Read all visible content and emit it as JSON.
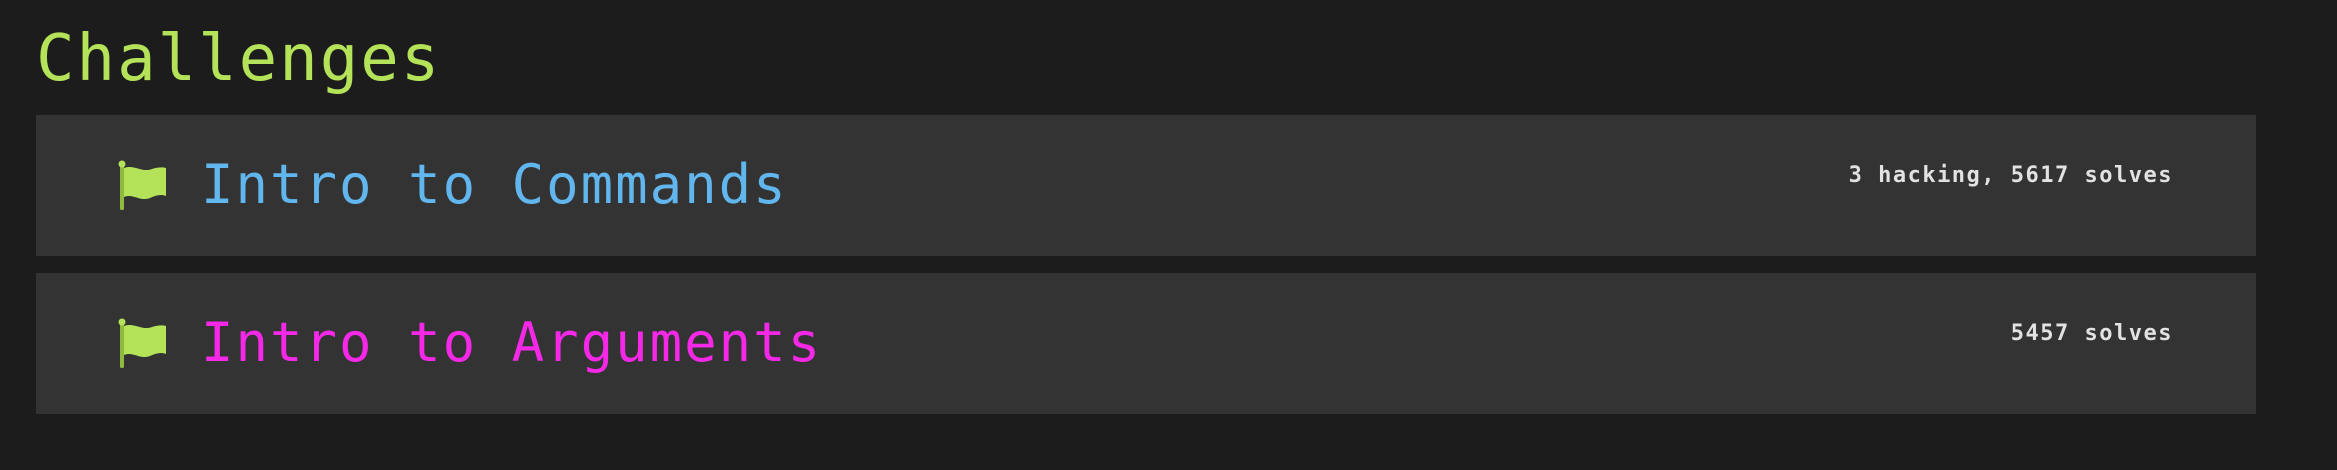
{
  "page": {
    "title": "Challenges"
  },
  "challenges": [
    {
      "name": "Intro to Commands",
      "stats": "3 hacking, 5617 solves",
      "name_color": "#62b6ee",
      "flag_icon": "flag-icon",
      "flag_color": "#b4e35a"
    },
    {
      "name": "Intro to Arguments",
      "stats": "5457 solves",
      "name_color": "#f428e6",
      "flag_icon": "flag-icon",
      "flag_color": "#b4e35a"
    }
  ]
}
